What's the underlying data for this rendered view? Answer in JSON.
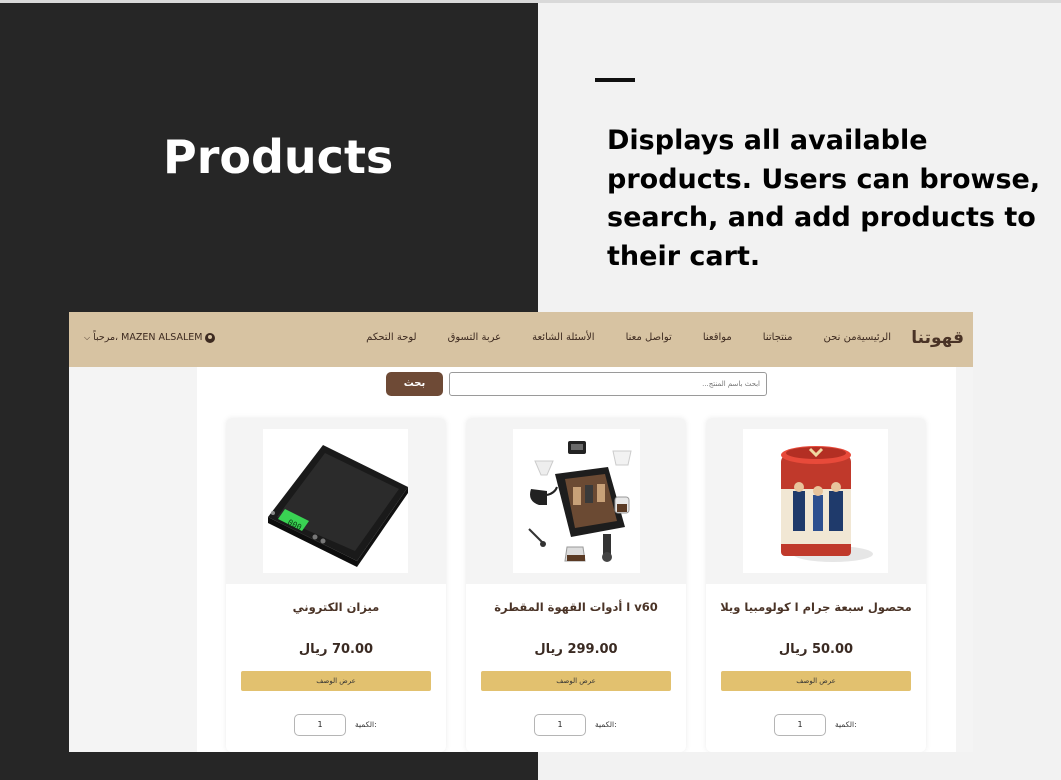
{
  "slide": {
    "title": "Products",
    "description": "Displays all available products. Users can browse, search, and add products to their cart."
  },
  "navbar": {
    "brand": "قهوتنا",
    "items": [
      "الرئيسية",
      "من نحن",
      "منتجاتنا",
      "مواقعنا",
      "تواصل معنا",
      "الأسئلة الشائعة",
      "عربة التسوق",
      "لوحة التحكم"
    ],
    "user_greeting": "مرحباً، MAZEN ALSALEM"
  },
  "search": {
    "placeholder": "ابحث باسم المنتج...",
    "button_label": "بحث"
  },
  "products": [
    {
      "title": "محصول سبعة جرام ا كولومبيا ويلا",
      "price": "50.00 ريال",
      "button_label": "عرض الوصف",
      "qty_label": "الكمية:",
      "qty_value": "1",
      "image_icon": "coffee-tin-icon"
    },
    {
      "title": "v60 ا أدوات القهوة المقطرة",
      "price": "299.00 ريال",
      "button_label": "عرض الوصف",
      "qty_label": "الكمية:",
      "qty_value": "1",
      "image_icon": "coffee-tools-kit-icon"
    },
    {
      "title": "ميزان الكتروني",
      "price": "70.00 ريال",
      "button_label": "عرض الوصف",
      "qty_label": "الكمية:",
      "qty_value": "1",
      "image_icon": "digital-scale-icon"
    }
  ],
  "colors": {
    "navbar_bg": "#d7c3a2",
    "search_button": "#6e4a36",
    "description_button": "#e2c16f",
    "slide_dark": "#262626"
  }
}
